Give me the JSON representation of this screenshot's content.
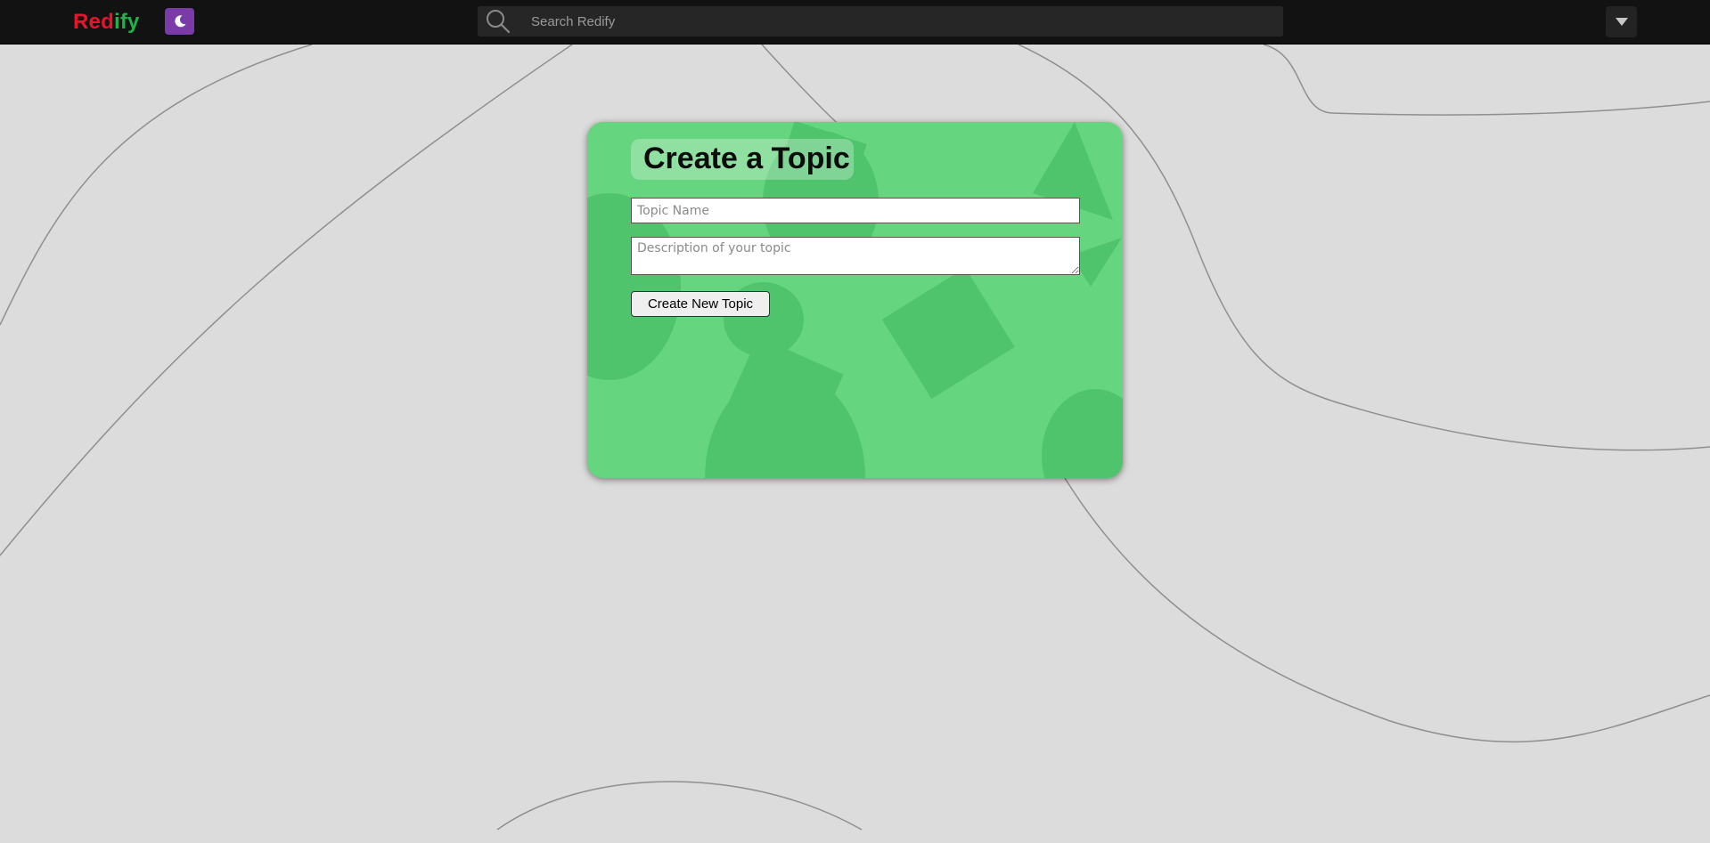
{
  "header": {
    "logo_part1": "Red",
    "logo_part2": "ify",
    "theme_toggle_icon": "moon-icon",
    "search_placeholder": "Search Redify",
    "search_icon": "search-icon",
    "user_menu_icon": "caret-down-icon"
  },
  "form": {
    "title": "Create a Topic",
    "topic_name_placeholder": "Topic Name",
    "description_placeholder": "Description of your topic",
    "submit_label": "Create New Topic"
  },
  "colors": {
    "topbar_bg": "#121212",
    "logo_red": "#e8142d",
    "logo_green": "#1fb24a",
    "theme_button": "#7a3aa8",
    "card_green": "#66d57f",
    "page_bg": "#dcdcdc"
  }
}
